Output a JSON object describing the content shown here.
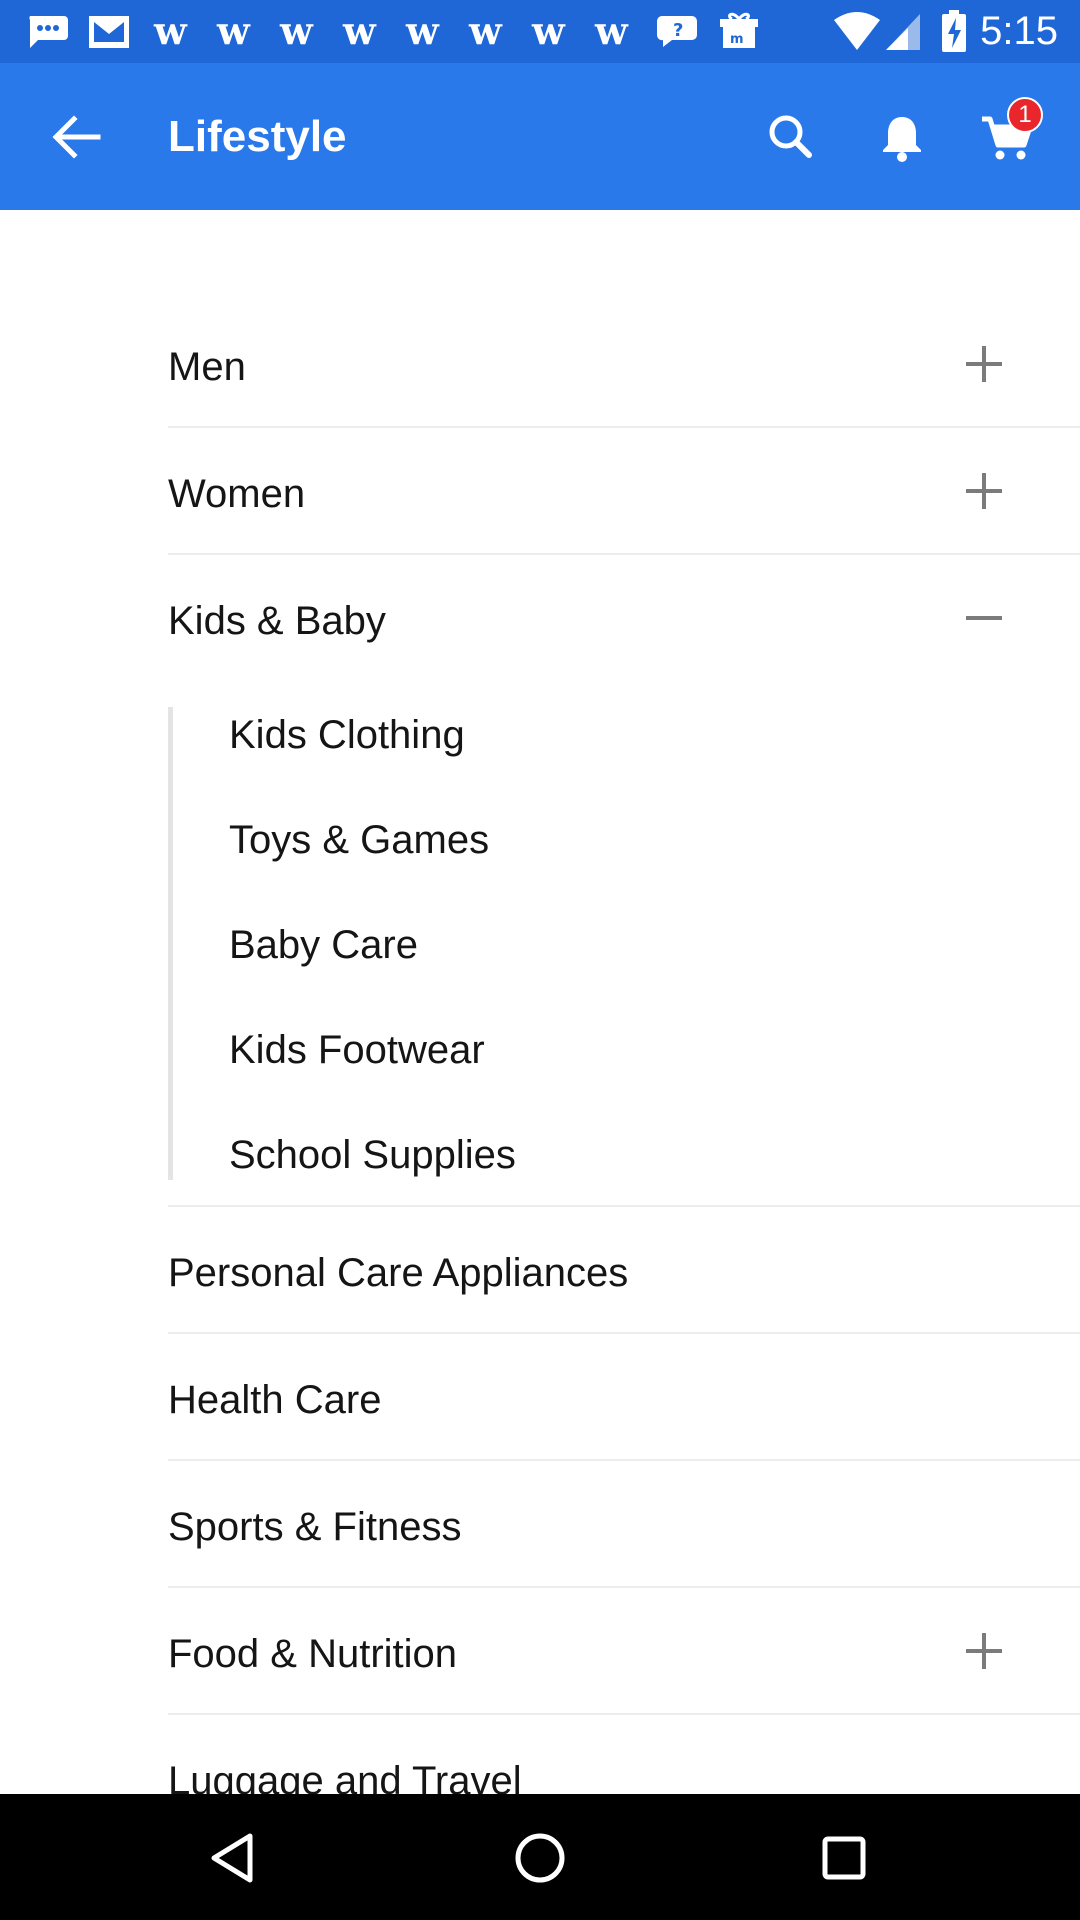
{
  "status_bar": {
    "time": "5:15",
    "icons": [
      "messages-icon",
      "gmail-icon",
      "w-app-icon",
      "w-app-icon",
      "w-app-icon",
      "w-app-icon",
      "w-app-icon",
      "w-app-icon",
      "w-app-icon",
      "w-app-icon",
      "chat-bubble-icon",
      "gift-box-icon",
      "wifi-icon",
      "signal-icon",
      "battery-charging-icon"
    ]
  },
  "app_bar": {
    "title": "Lifestyle",
    "cart_count": "1",
    "icons": [
      "back-arrow-icon",
      "search-icon",
      "bell-icon",
      "cart-icon"
    ],
    "color": "#2a79ea"
  },
  "categories": [
    {
      "label": "Men",
      "toggle": "plus"
    },
    {
      "label": "Women",
      "toggle": "plus"
    },
    {
      "label": "Kids & Baby",
      "toggle": "minus",
      "expanded": true,
      "subcategories": [
        "Kids Clothing",
        "Toys & Games",
        "Baby Care",
        "Kids Footwear",
        "School Supplies"
      ]
    },
    {
      "label": "Personal Care Appliances"
    },
    {
      "label": "Health Care"
    },
    {
      "label": "Sports & Fitness"
    },
    {
      "label": "Food & Nutrition",
      "toggle": "plus"
    },
    {
      "label": "Luggage and Travel"
    }
  ],
  "nav_bar": {
    "icons": [
      "nav-back-icon",
      "nav-home-icon",
      "nav-recents-icon"
    ]
  }
}
